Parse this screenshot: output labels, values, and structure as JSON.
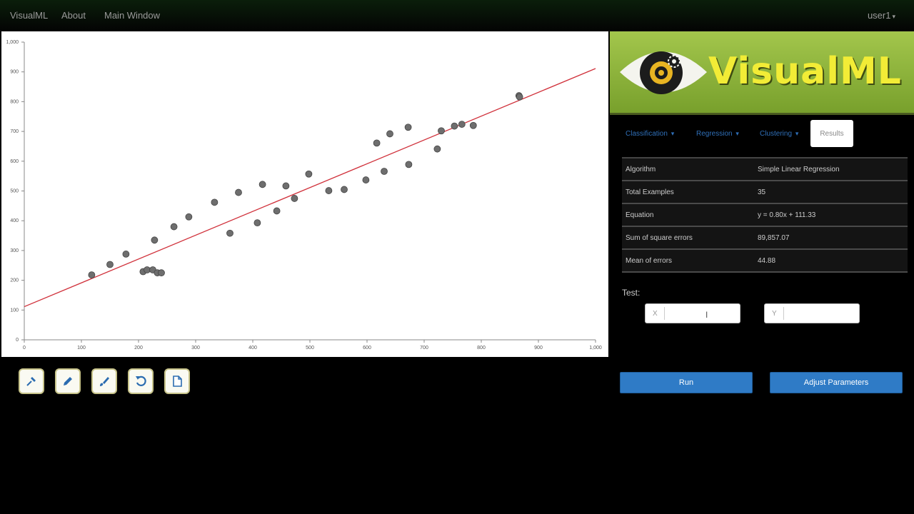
{
  "navbar": {
    "brand": "VisualML",
    "about": "About",
    "main_window": "Main Window",
    "user": "user1"
  },
  "logo": {
    "text": "VisualML"
  },
  "tabs": {
    "classification": "Classification",
    "regression": "Regression",
    "clustering": "Clustering",
    "results": "Results"
  },
  "results": [
    {
      "label": "Algorithm",
      "value": "Simple Linear Regression"
    },
    {
      "label": "Total Examples",
      "value": "35"
    },
    {
      "label": "Equation",
      "value": "y = 0.80x + 111.33"
    },
    {
      "label": "Sum of square errors",
      "value": "89,857.07"
    },
    {
      "label": "Mean of errors",
      "value": "44.88"
    }
  ],
  "test": {
    "label": "Test:",
    "x_placeholder": "X",
    "y_placeholder": "Y"
  },
  "buttons": {
    "run": "Run",
    "adjust": "Adjust Parameters"
  },
  "colors": {
    "accent": "#2f7bc6",
    "regression_line": "#d0303a",
    "point": "#6e6e6e",
    "logo_text": "#f2ec36",
    "logo_bg": "#8ab33a"
  },
  "icons": [
    "pin-icon",
    "pencil-icon",
    "brush-icon",
    "undo-icon",
    "new-document-icon"
  ],
  "chart_data": {
    "type": "scatter",
    "xlim": [
      0,
      1000
    ],
    "ylim": [
      0,
      1000
    ],
    "x_ticks": [
      0,
      100,
      200,
      300,
      400,
      500,
      600,
      700,
      800,
      900,
      1000
    ],
    "y_ticks": [
      0,
      100,
      200,
      300,
      400,
      500,
      600,
      700,
      800,
      900,
      1000
    ],
    "tick_format": "thousands_separator",
    "grid": false,
    "points": [
      [
        118,
        218
      ],
      [
        150,
        253
      ],
      [
        178,
        288
      ],
      [
        208,
        229
      ],
      [
        215,
        235
      ],
      [
        225,
        235
      ],
      [
        228,
        335
      ],
      [
        233,
        225
      ],
      [
        240,
        225
      ],
      [
        262,
        380
      ],
      [
        288,
        413
      ],
      [
        333,
        462
      ],
      [
        360,
        358
      ],
      [
        375,
        495
      ],
      [
        408,
        393
      ],
      [
        417,
        522
      ],
      [
        442,
        433
      ],
      [
        458,
        517
      ],
      [
        473,
        475
      ],
      [
        498,
        557
      ],
      [
        533,
        501
      ],
      [
        560,
        505
      ],
      [
        598,
        537
      ],
      [
        617,
        661
      ],
      [
        630,
        566
      ],
      [
        640,
        692
      ],
      [
        672,
        714
      ],
      [
        673,
        589
      ],
      [
        723,
        641
      ],
      [
        730,
        702
      ],
      [
        753,
        718
      ],
      [
        766,
        724
      ],
      [
        786,
        720
      ],
      [
        866,
        820
      ],
      [
        867,
        816
      ]
    ],
    "line": {
      "slope": 0.8,
      "intercept": 111.33
    }
  }
}
